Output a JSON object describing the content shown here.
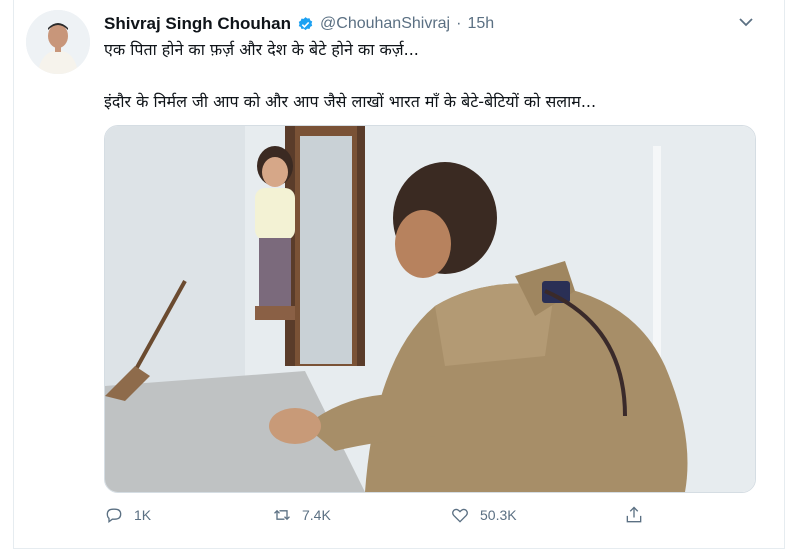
{
  "tweet": {
    "author_name": "Shivraj Singh Chouhan",
    "handle": "@ChouhanShivraj",
    "separator": "·",
    "time": "15h",
    "line1": "एक पिता होने का फ़र्ज़ और देश के बेटे होने का कर्ज़...",
    "line2": "इंदौर के निर्मल जी आप को और आप जैसे लाखों भारत माँ के बेटे-बेटियों को सलाम..."
  },
  "actions": {
    "reply_count": "1K",
    "retweet_count": "7.4K",
    "like_count": "50.3K"
  },
  "icons": {
    "verified": "verified-badge-icon",
    "menu": "chevron-down-icon",
    "reply": "reply-icon",
    "retweet": "retweet-icon",
    "like": "heart-icon",
    "share": "share-icon"
  },
  "colors": {
    "text": "#0f1419",
    "secondary": "#5b7083",
    "verified": "#1da1f2"
  }
}
